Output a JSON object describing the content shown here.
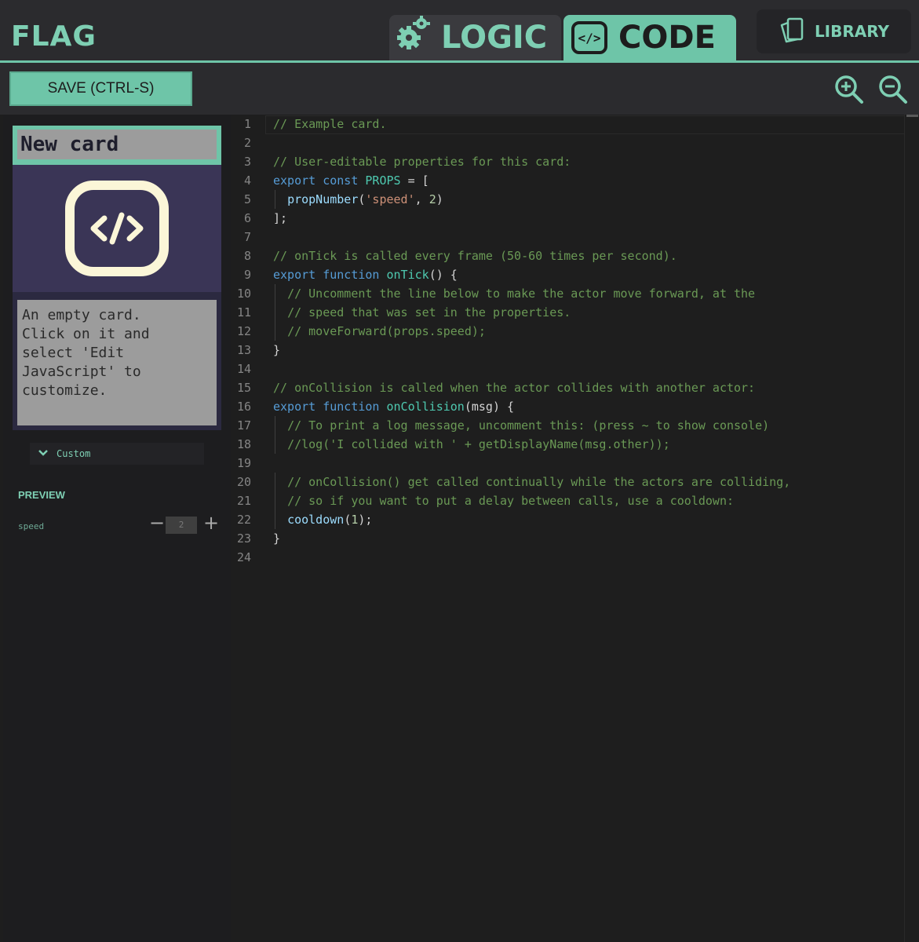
{
  "header": {
    "title": "FLAG",
    "tabs": [
      {
        "label": "LOGIC",
        "icon": "gears-icon",
        "active": false
      },
      {
        "label": "CODE",
        "icon": "code-icon",
        "active": true
      }
    ],
    "library_label": "LIBRARY"
  },
  "toolbar": {
    "save_label": "SAVE (CTRL-S)",
    "zoom_in_icon": "zoom-in-icon",
    "zoom_out_icon": "zoom-out-icon"
  },
  "card": {
    "title": "New card",
    "description": "An empty card.\nClick on it and\nselect 'Edit\nJavaScript' to\ncustomize.",
    "category": "Custom"
  },
  "preview": {
    "label": "PREVIEW",
    "props": [
      {
        "name": "speed",
        "value": "2",
        "minus": "−",
        "plus": "+"
      }
    ]
  },
  "editor": {
    "lines": [
      "// Example card.",
      "",
      "// User-editable properties for this card:",
      "export const PROPS = [",
      "  propNumber('speed', 2)",
      "];",
      "",
      "// onTick is called every frame (50-60 times per second).",
      "export function onTick() {",
      "  // Uncomment the line below to make the actor move forward, at the",
      "  // speed that was set in the properties.",
      "  // moveForward(props.speed);",
      "}",
      "",
      "// onCollision is called when the actor collides with another actor:",
      "export function onCollision(msg) {",
      "  // To print a log message, uncomment this: (press ~ to show console)",
      "  //log('I collided with ' + getDisplayName(msg.other));",
      "",
      "  // onCollision() get called continually while the actors are colliding,",
      "  // so if you want to put a delay between calls, use a cooldown:",
      "  cooldown(1);",
      "}",
      ""
    ]
  },
  "colors": {
    "accent": "#6ec5a8",
    "card_bg": "#3a3556",
    "comment": "#6a9955",
    "keyword": "#569cd6",
    "function_name": "#4ec9b0",
    "string": "#ce9178"
  }
}
